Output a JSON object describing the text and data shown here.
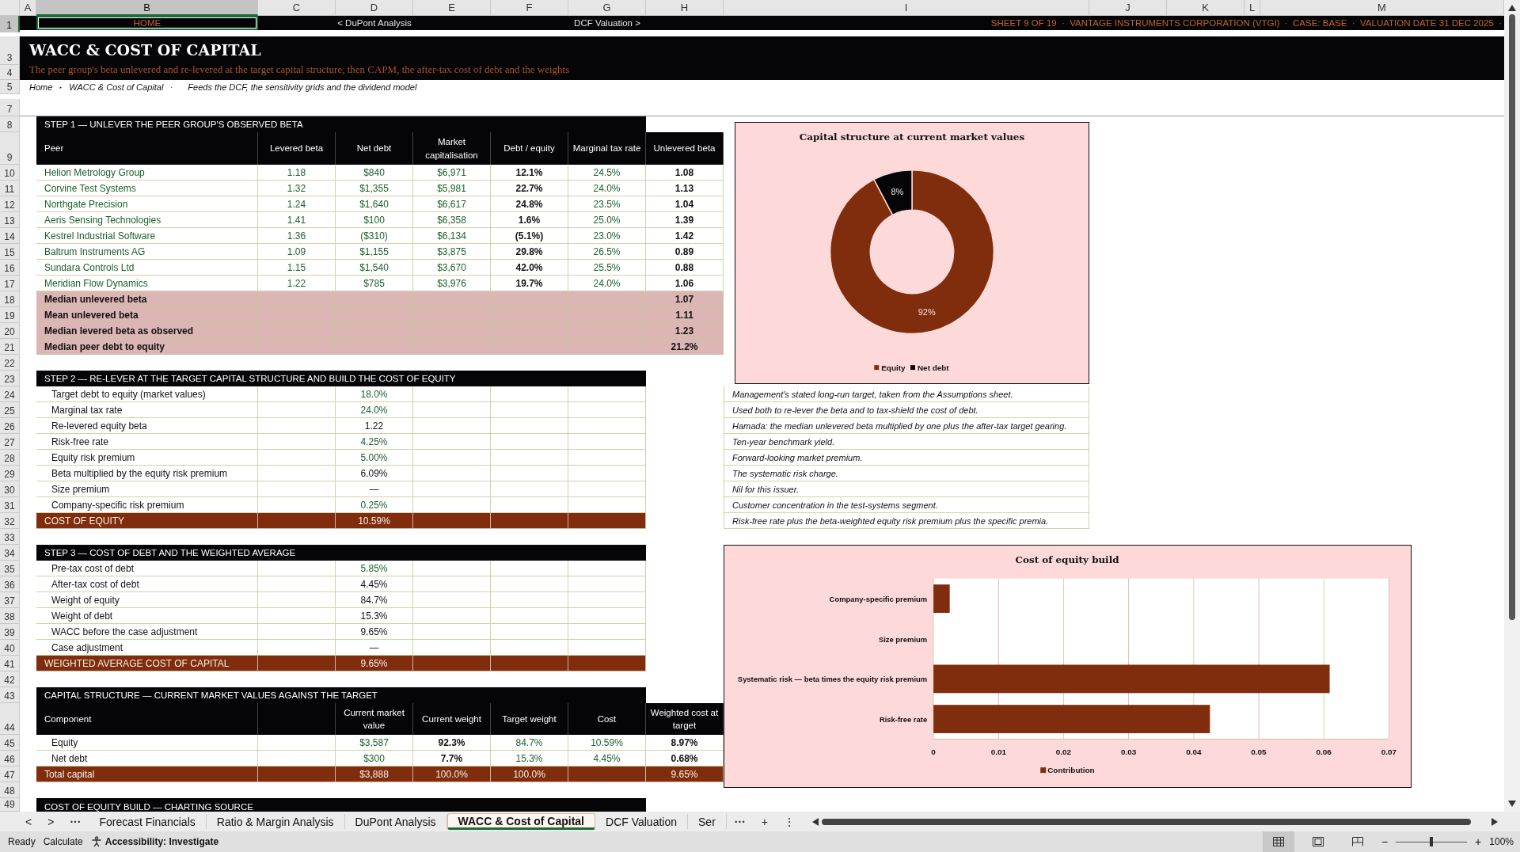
{
  "column_headers": [
    {
      "label": "A",
      "selected": false
    },
    {
      "label": "B",
      "selected": true
    },
    {
      "label": "C",
      "selected": false
    },
    {
      "label": "D",
      "selected": false
    },
    {
      "label": "E",
      "selected": false
    },
    {
      "label": "F",
      "selected": false
    },
    {
      "label": "G",
      "selected": false
    },
    {
      "label": "H",
      "selected": false
    },
    {
      "label": "I",
      "selected": false
    },
    {
      "label": "J",
      "selected": false
    },
    {
      "label": "K",
      "selected": false
    },
    {
      "label": "L",
      "selected": false
    },
    {
      "label": "M",
      "selected": false
    }
  ],
  "row_numbers": [
    {
      "label": "1",
      "selected": true
    },
    {
      "label": "3",
      "selected": false
    },
    {
      "label": "4",
      "selected": false
    },
    {
      "label": "5",
      "selected": false
    },
    {
      "label": "7",
      "selected": false
    },
    {
      "label": "8",
      "selected": false
    },
    {
      "label": "9",
      "selected": false
    },
    {
      "label": "10",
      "selected": false
    },
    {
      "label": "11",
      "selected": false
    },
    {
      "label": "12",
      "selected": false
    },
    {
      "label": "13",
      "selected": false
    },
    {
      "label": "14",
      "selected": false
    },
    {
      "label": "15",
      "selected": false
    },
    {
      "label": "16",
      "selected": false
    },
    {
      "label": "17",
      "selected": false
    },
    {
      "label": "18",
      "selected": false
    },
    {
      "label": "19",
      "selected": false
    },
    {
      "label": "20",
      "selected": false
    },
    {
      "label": "21",
      "selected": false
    },
    {
      "label": "22",
      "selected": false
    },
    {
      "label": "23",
      "selected": false
    },
    {
      "label": "24",
      "selected": false
    },
    {
      "label": "25",
      "selected": false
    },
    {
      "label": "26",
      "selected": false
    },
    {
      "label": "27",
      "selected": false
    },
    {
      "label": "28",
      "selected": false
    },
    {
      "label": "29",
      "selected": false
    },
    {
      "label": "30",
      "selected": false
    },
    {
      "label": "31",
      "selected": false
    },
    {
      "label": "32",
      "selected": false
    },
    {
      "label": "33",
      "selected": false
    },
    {
      "label": "34",
      "selected": false
    },
    {
      "label": "35",
      "selected": false
    },
    {
      "label": "36",
      "selected": false
    },
    {
      "label": "37",
      "selected": false
    },
    {
      "label": "38",
      "selected": false
    },
    {
      "label": "39",
      "selected": false
    },
    {
      "label": "40",
      "selected": false
    },
    {
      "label": "41",
      "selected": false
    },
    {
      "label": "42",
      "selected": false
    },
    {
      "label": "43",
      "selected": false
    },
    {
      "label": "44",
      "selected": false
    },
    {
      "label": "45",
      "selected": false
    },
    {
      "label": "46",
      "selected": false
    },
    {
      "label": "47",
      "selected": false
    },
    {
      "label": "48",
      "selected": false
    },
    {
      "label": "49",
      "selected": false
    }
  ],
  "nav": {
    "home": {
      "label": "HOME",
      "selected": true
    },
    "prev": "<  DuPont Analysis",
    "next": "DCF Valuation  >",
    "info": "SHEET 9 OF 19  ·  VANTAGE INSTRUMENTS CORPORATION (VTGI)  ·  CASE: BASE  ·  VALUATION DATE 31 DEC 2025  ·"
  },
  "title": "WACC & COST OF CAPITAL",
  "subtitle": "The peer group's beta unlevered and re-levered at the target capital structure, then CAPM, the after-tax cost of debt and the weights",
  "breadcrumb": [
    {
      "text": "Home",
      "kind": "link"
    },
    {
      "text": "‣",
      "kind": "sep"
    },
    {
      "text": "WACC & Cost of Capital",
      "kind": "link"
    },
    {
      "text": "·",
      "kind": "sep"
    },
    {
      "text": "Feeds the DCF, the sensitivity grids and the dividend model",
      "kind": "note"
    }
  ],
  "step1": {
    "heading": "STEP 1 — UNLEVER THE PEER GROUP'S OBSERVED BETA",
    "columns": [
      {
        "label": "Peer",
        "linked": true
      },
      {
        "label": "Levered beta",
        "linked": true
      },
      {
        "label": "Net debt",
        "linked": true
      },
      {
        "label": "Market capitalisation",
        "linked": true
      },
      {
        "label": "Debt / equity",
        "linked": false
      },
      {
        "label": "Marginal tax rate",
        "linked": true
      },
      {
        "label": "Unlevered beta",
        "linked": false
      }
    ],
    "peers": [
      [
        "Helion Metrology Group",
        "1.18",
        "$840",
        "$6,971",
        "12.1%",
        "24.5%",
        "1.08"
      ],
      [
        "Corvine Test Systems",
        "1.32",
        "$1,355",
        "$5,981",
        "22.7%",
        "24.0%",
        "1.13"
      ],
      [
        "Northgate Precision",
        "1.24",
        "$1,640",
        "$6,617",
        "24.8%",
        "23.5%",
        "1.04"
      ],
      [
        "Aeris Sensing Technologies",
        "1.41",
        "$100",
        "$6,358",
        "1.6%",
        "25.0%",
        "1.39"
      ],
      [
        "Kestrel Industrial Software",
        "1.36",
        "($310)",
        "$6,134",
        "(5.1%)",
        "23.0%",
        "1.42"
      ],
      [
        "Baltrum Instruments AG",
        "1.09",
        "$1,155",
        "$3,875",
        "29.8%",
        "26.5%",
        "0.89"
      ],
      [
        "Sundara Controls Ltd",
        "1.15",
        "$1,540",
        "$3,670",
        "42.0%",
        "25.5%",
        "0.88"
      ],
      [
        "Meridian Flow Dynamics",
        "1.22",
        "$785",
        "$3,976",
        "19.7%",
        "24.0%",
        "1.06"
      ]
    ],
    "summary": [
      {
        "label": "Median unlevered beta",
        "value": "1.07"
      },
      {
        "label": "Mean unlevered beta",
        "value": "1.11"
      },
      {
        "label": "Median levered beta as observed",
        "value": "1.23"
      },
      {
        "label": "Median peer debt to equity",
        "value": "21.2%"
      }
    ]
  },
  "step2": {
    "heading": "STEP 2 — RE-LEVER AT THE TARGET CAPITAL STRUCTURE AND BUILD THE COST OF EQUITY",
    "rows": [
      {
        "label": "Target debt to equity (market values)",
        "value": "18.0%",
        "linked": true,
        "note": "Management's stated long-run target, taken from the Assumptions sheet."
      },
      {
        "label": "Marginal tax rate",
        "value": "24.0%",
        "linked": true,
        "note": "Used both to re-lever the beta and to tax-shield the cost of debt."
      },
      {
        "label": "Re-levered equity beta",
        "value": "1.22",
        "linked": false,
        "note": "Hamada: the median unlevered beta multiplied by one plus the after-tax target gearing."
      },
      {
        "label": "Risk-free rate",
        "value": "4.25%",
        "linked": true,
        "note": "Ten-year benchmark yield."
      },
      {
        "label": "Equity risk premium",
        "value": "5.00%",
        "linked": true,
        "note": "Forward-looking market premium."
      },
      {
        "label": "Beta multiplied by the equity risk premium",
        "value": "6.09%",
        "linked": false,
        "note": "The systematic risk charge."
      },
      {
        "label": "Size premium",
        "value": "—",
        "linked": false,
        "note": "Nil for this issuer."
      },
      {
        "label": "Company-specific risk premium",
        "value": "0.25%",
        "linked": true,
        "note": "Customer concentration in the test-systems segment."
      }
    ],
    "total": {
      "label": "COST OF EQUITY",
      "value": "10.59%",
      "note": "Risk-free rate plus the beta-weighted equity risk premium plus the specific premia."
    }
  },
  "step3": {
    "heading": "STEP 3 — COST OF DEBT AND THE WEIGHTED AVERAGE",
    "rows": [
      {
        "label": "Pre-tax cost of debt",
        "value": "5.85%",
        "linked": true
      },
      {
        "label": "After-tax cost of debt",
        "value": "4.45%",
        "linked": false
      },
      {
        "label": "Weight of equity",
        "value": "84.7%",
        "linked": false
      },
      {
        "label": "Weight of debt",
        "value": "15.3%",
        "linked": false
      },
      {
        "label": "WACC before the case adjustment",
        "value": "9.65%",
        "linked": false
      },
      {
        "label": "Case adjustment",
        "value": "—",
        "linked": false
      }
    ],
    "total": {
      "label": "WEIGHTED AVERAGE COST OF CAPITAL",
      "value": "9.65%"
    }
  },
  "capital": {
    "heading": "CAPITAL STRUCTURE — CURRENT MARKET VALUES AGAINST THE TARGET",
    "columns": [
      {
        "label": "Component",
        "linked": false
      },
      {
        "label": "Current market value",
        "linked": true
      },
      {
        "label": "Current weight",
        "linked": false
      },
      {
        "label": "Target weight",
        "linked": true
      },
      {
        "label": "Cost",
        "linked": true
      },
      {
        "label": "Weighted cost at target",
        "linked": false
      }
    ],
    "rows": [
      [
        "Equity",
        "$3,587",
        "92.3%",
        "84.7%",
        "10.59%",
        "8.97%"
      ],
      [
        "Net debt",
        "$300",
        "7.7%",
        "15.3%",
        "4.45%",
        "0.68%"
      ]
    ],
    "total": {
      "label": "Total capital",
      "current_value": "$3,888",
      "current_weight": "100.0%",
      "target_weight": "100.0%",
      "weighted_cost": "9.65%"
    }
  },
  "next_heading": "COST OF EQUITY BUILD — CHARTING SOURCE",
  "donut": {
    "chart_data": {
      "type": "donut",
      "title": "Capital structure at current market values",
      "categories": [
        "Equity",
        "Net debt"
      ],
      "values": [
        92.3,
        7.7
      ],
      "colors": [
        "#7f2d0c",
        "#050508"
      ],
      "value_labels": [
        "92%",
        "8%"
      ],
      "legend": "bottom"
    }
  },
  "bars": {
    "chart_data": {
      "type": "bar",
      "orientation": "horizontal",
      "title": "Cost of equity build",
      "categories": [
        "Company-specific premium",
        "Size premium",
        "Systematic risk — beta times the equity risk premium",
        "Risk-free rate"
      ],
      "series": [
        {
          "name": "Contribution",
          "color": "#7f2d0c",
          "values": [
            0.0025,
            0,
            0.0609,
            0.0425
          ]
        }
      ],
      "xlim": [
        0,
        0.07
      ],
      "xticks": [
        0,
        0.01,
        0.02,
        0.03,
        0.04,
        0.05,
        0.06,
        0.07
      ],
      "grid": true,
      "legend": "bottom"
    }
  },
  "tabs": {
    "prev": "<",
    "next": ">",
    "more_left": "···",
    "items": [
      {
        "label": "Forecast Financials",
        "selected": false
      },
      {
        "label": "Ratio & Margin Analysis",
        "selected": false
      },
      {
        "label": "DuPont Analysis",
        "selected": false
      },
      {
        "label": "WACC & Cost of Capital",
        "selected": true
      },
      {
        "label": "DCF Valuation",
        "selected": false
      },
      {
        "label": "Ser",
        "selected": false
      }
    ],
    "more_right": "···",
    "add": "+",
    "options": "⋮"
  },
  "status_bar": {
    "ready": "Ready",
    "calculate": "Calculate",
    "accessibility": "Accessibility: Investigate",
    "zoom_minus": "−",
    "zoom_plus": "+",
    "zoom": {
      "level": 0.5,
      "reading": "100%"
    }
  }
}
